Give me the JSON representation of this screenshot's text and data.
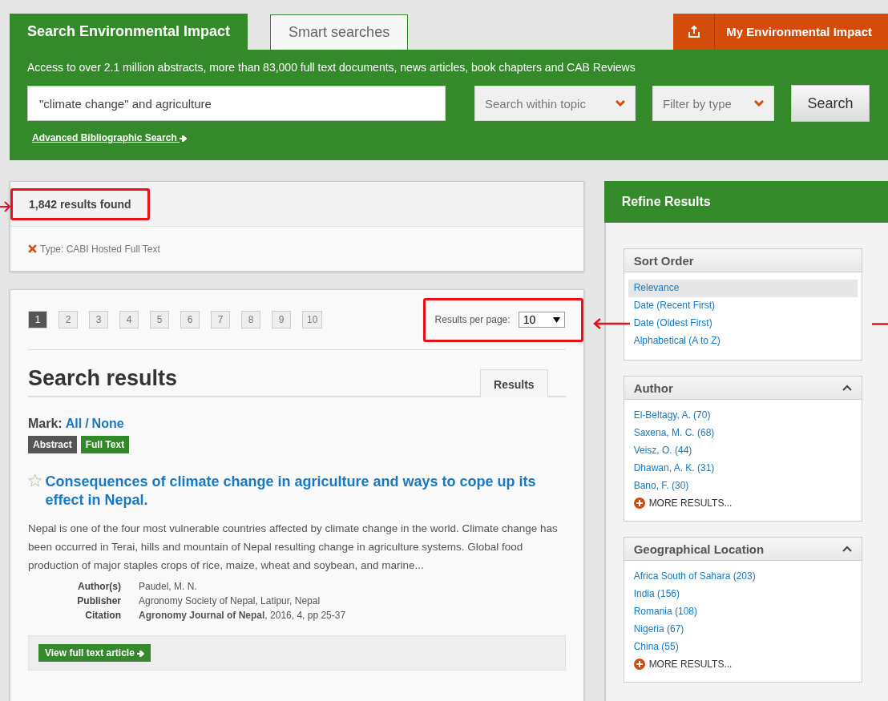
{
  "header": {
    "tabs": [
      {
        "label": "Search Environmental Impact",
        "selected": true
      },
      {
        "label": "Smart searches",
        "selected": false
      }
    ],
    "account_button": "My Environmental Impact",
    "description": "Access to over 2.1 million abstracts, more than 83,000 full text documents, news articles, book chapters and CAB Reviews",
    "search": {
      "value": "\"climate change\" and agriculture"
    },
    "dropdowns": [
      "Search within topic",
      "Filter by type"
    ],
    "search_button": "Search",
    "advanced_link": "Advanced Bibliographic Search"
  },
  "summary": {
    "count": "1,842 results found",
    "highlighted": true,
    "filters": [
      {
        "label": "Type: CABI Hosted Full Text"
      }
    ]
  },
  "results": {
    "pages": [
      {
        "label": "1",
        "selected": true
      },
      {
        "label": "2",
        "selected": false
      },
      {
        "label": "3",
        "selected": false
      },
      {
        "label": "4",
        "selected": false
      },
      {
        "label": "5",
        "selected": false
      },
      {
        "label": "6",
        "selected": false
      },
      {
        "label": "7",
        "selected": false
      },
      {
        "label": "8",
        "selected": false
      },
      {
        "label": "9",
        "selected": false
      },
      {
        "label": "10",
        "selected": false
      }
    ],
    "per_page": {
      "label": "Results per page:",
      "value": "10",
      "highlighted": true
    },
    "title": "Search results",
    "tab": "Results",
    "mark": {
      "label": "Mark:",
      "options": [
        "All",
        "None"
      ],
      "separator": "/"
    },
    "badges": [
      {
        "label": "Abstract",
        "color": "#555555"
      },
      {
        "label": "Full Text",
        "color": "#2f8a25"
      }
    ],
    "items": [
      {
        "starred": false,
        "title": "Consequences of climate change in agriculture and ways to cope up its effect in Nepal.",
        "abstract": "Nepal is one of the four most vulnerable countries affected by climate change in the world. Climate change has been occurred in Terai, hills and mountain of Nepal resulting change in agriculture systems. Global food production of major staples crops of rice, maize, wheat and soybean, and marine...",
        "meta": [
          {
            "label": "Author(s)",
            "value": "Paudel, M. N."
          },
          {
            "label": "Publisher",
            "value": "Agronomy Society of Nepal, Latipur, Nepal"
          },
          {
            "label": "Citation",
            "value": "**Agronomy Journal of Nepal**, 2016, 4, pp 25-37"
          }
        ],
        "action": "View full text article"
      }
    ]
  },
  "refine": {
    "title": "Refine Results",
    "groups": [
      {
        "title": "Sort Order",
        "collapsible": false,
        "items": [
          {
            "label": "Relevance",
            "selected": true
          },
          {
            "label": "Date (Recent First)",
            "selected": false
          },
          {
            "label": "Date (Oldest First)",
            "selected": false
          },
          {
            "label": "Alphabetical (A to Z)",
            "selected": false
          }
        ]
      },
      {
        "title": "Author",
        "collapsible": true,
        "items": [
          {
            "label": "El-Beltagy, A. (70)",
            "selected": false
          },
          {
            "label": "Saxena, M. C. (68)",
            "selected": false
          },
          {
            "label": "Veisz, O. (44)",
            "selected": false
          },
          {
            "label": "Dhawan, A. K. (31)",
            "selected": false
          },
          {
            "label": "Bano, F. (30)",
            "selected": false
          }
        ],
        "more": "MORE RESULTS..."
      },
      {
        "title": "Geographical Location",
        "collapsible": true,
        "items": [
          {
            "label": "Africa South of Sahara (203)",
            "selected": false
          },
          {
            "label": "India (156)",
            "selected": false
          },
          {
            "label": "Romania (108)",
            "selected": false
          },
          {
            "label": "Nigeria (67)",
            "selected": false
          },
          {
            "label": "China (55)",
            "selected": false
          }
        ],
        "more": "MORE RESULTS..."
      }
    ]
  }
}
